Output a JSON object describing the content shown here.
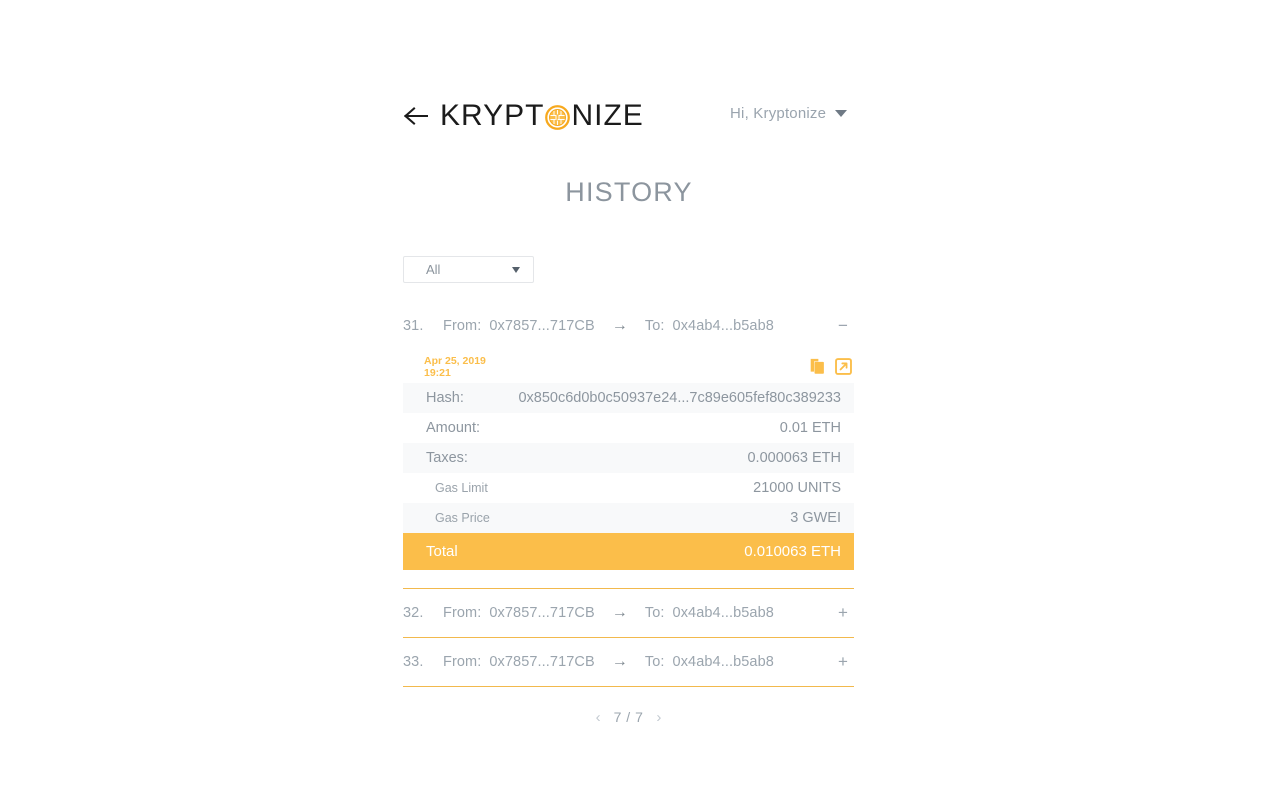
{
  "header": {
    "back_icon": "arrow-left-icon",
    "logo_part1": "KRYPT",
    "logo_coin_icon": "coin-icon",
    "logo_part2": "NIZE",
    "greeting": "Hi, Kryptonize",
    "greeting_caret_icon": "chevron-down-icon"
  },
  "page": {
    "title": "HISTORY"
  },
  "filter": {
    "selected": "All",
    "caret_icon": "chevron-down-icon",
    "options": [
      "All"
    ]
  },
  "transactions": [
    {
      "index": "31.",
      "from_label": "From:",
      "from_address": "0x7857...717CB",
      "arrow": "→",
      "to_label": "To:",
      "to_address": "0x4ab4...b5ab8",
      "toggle": "−",
      "expanded": true,
      "detail": {
        "date": "Apr 25, 2019",
        "time": "19:21",
        "copy_icon": "copy-icon",
        "external_icon": "external-link-icon",
        "rows": [
          {
            "key": "Hash:",
            "value": "0x850c6d0b0c50937e24...7c89e605fef80c389233"
          },
          {
            "key": "Amount:",
            "value": "0.01 ETH"
          },
          {
            "key": "Taxes:",
            "value": "0.000063 ETH"
          },
          {
            "key": "Gas Limit",
            "value": "21000 UNITS"
          },
          {
            "key": "Gas Price",
            "value": "3 GWEI"
          },
          {
            "key": "Total",
            "value": "0.010063 ETH"
          }
        ]
      }
    },
    {
      "index": "32.",
      "from_label": "From:",
      "from_address": "0x7857...717CB",
      "arrow": "→",
      "to_label": "To:",
      "to_address": "0x4ab4...b5ab8",
      "toggle": "+",
      "expanded": false
    },
    {
      "index": "33.",
      "from_label": "From:",
      "from_address": "0x7857...717CB",
      "arrow": "→",
      "to_label": "To:",
      "to_address": "0x4ab4...b5ab8",
      "toggle": "+",
      "expanded": false
    }
  ],
  "pagination": {
    "prev_icon": "‹",
    "page_indicator": "7 / 7",
    "next_icon": "›"
  },
  "colors": {
    "accent": "#fbbe4a",
    "divider": "#f0ad2e",
    "text_muted": "#9ba5ae",
    "title": "#8c959e"
  }
}
